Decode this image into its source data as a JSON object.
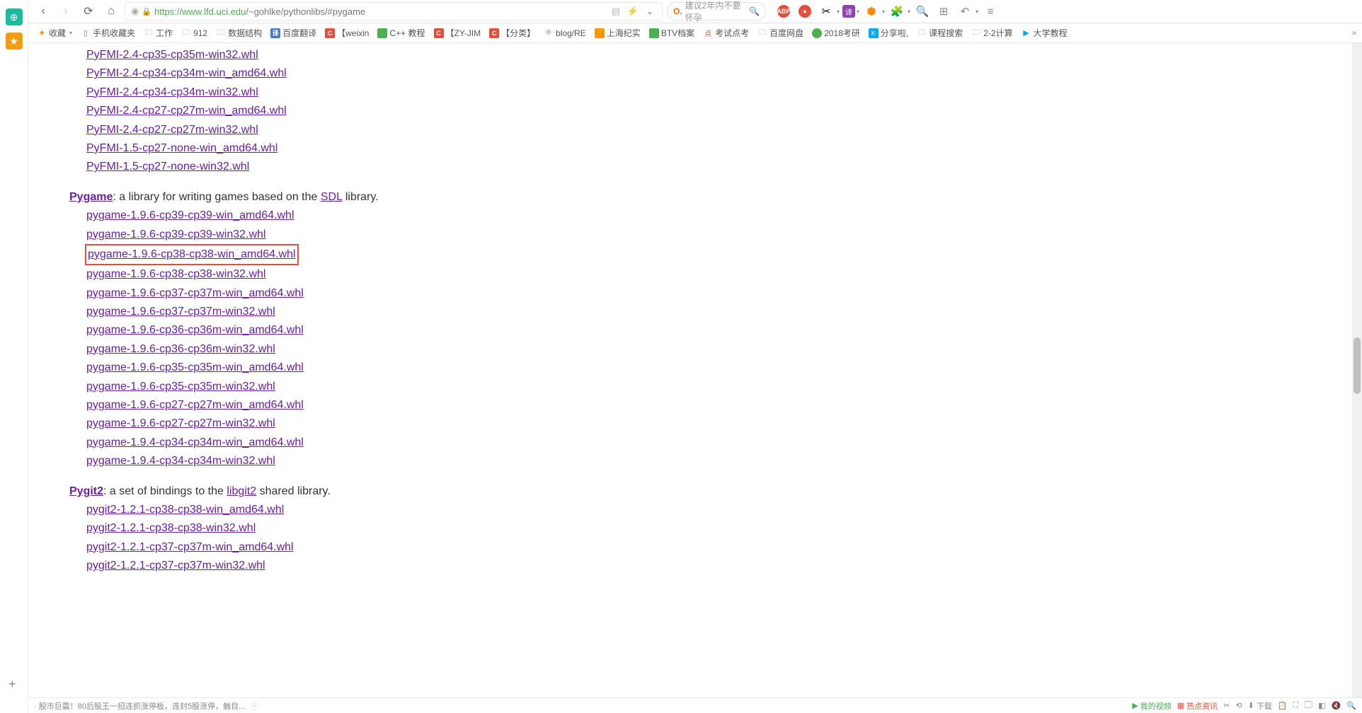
{
  "url": {
    "lock": "🔒",
    "protocol_host": "https://www.lfd.uci.edu",
    "path": "/~gohlke/pythonlibs/",
    "hash": "#pygame"
  },
  "search_suggestion": "建议2年内不要怀孕",
  "bookmarks": [
    {
      "icon": "star",
      "label": "收藏"
    },
    {
      "icon": "phone",
      "label": "手机收藏夹"
    },
    {
      "icon": "folder",
      "label": "工作"
    },
    {
      "icon": "folder",
      "label": "912"
    },
    {
      "icon": "folder",
      "label": "数据结构"
    },
    {
      "icon": "sq-blue",
      "iconText": "译",
      "label": "百度翻译"
    },
    {
      "icon": "sq-red",
      "iconText": "C",
      "label": "【weixin"
    },
    {
      "icon": "sq-green",
      "iconText": "",
      "label": "C++ 教程"
    },
    {
      "icon": "sq-red",
      "iconText": "C",
      "label": "【ZY-JIM"
    },
    {
      "icon": "sq-red",
      "iconText": "C",
      "label": "【分类】"
    },
    {
      "icon": "gh",
      "iconText": "⌾",
      "label": "blog/RE"
    },
    {
      "icon": "sq-orange",
      "iconText": "",
      "label": "上海纪实"
    },
    {
      "icon": "sq-green",
      "iconText": "",
      "label": "BTV档案"
    },
    {
      "icon": "dot-red",
      "iconText": "点",
      "label": "考试点考"
    },
    {
      "icon": "folder",
      "label": "百度网盘"
    },
    {
      "icon": "circ-green",
      "iconText": "",
      "label": "2018考研"
    },
    {
      "icon": "sq-cyan",
      "iconText": "K",
      "label": "分享啦,"
    },
    {
      "icon": "folder",
      "label": "课程搜索"
    },
    {
      "icon": "folder",
      "label": "2-2计算"
    },
    {
      "icon": "circ-blue",
      "iconText": "▶",
      "label": "大学教程"
    }
  ],
  "sections": {
    "pyfmi": {
      "files": [
        "PyFMI-2.4-cp35-cp35m-win32.whl",
        "PyFMI-2.4-cp34-cp34m-win_amd64.whl",
        "PyFMI-2.4-cp34-cp34m-win32.whl",
        "PyFMI-2.4-cp27-cp27m-win_amd64.whl",
        "PyFMI-2.4-cp27-cp27m-win32.whl",
        "PyFMI-1.5-cp27-none-win_amd64.whl",
        "PyFMI-1.5-cp27-none-win32.whl"
      ]
    },
    "pygame": {
      "title": "Pygame",
      "desc_pre": ": a library for writing games based on the ",
      "desc_link": "SDL",
      "desc_post": " library.",
      "files": [
        "pygame-1.9.6-cp39-cp39-win_amd64.whl",
        "pygame-1.9.6-cp39-cp39-win32.whl",
        "pygame-1.9.6-cp38-cp38-win_amd64.whl",
        "pygame-1.9.6-cp38-cp38-win32.whl",
        "pygame-1.9.6-cp37-cp37m-win_amd64.whl",
        "pygame-1.9.6-cp37-cp37m-win32.whl",
        "pygame-1.9.6-cp36-cp36m-win_amd64.whl",
        "pygame-1.9.6-cp36-cp36m-win32.whl",
        "pygame-1.9.6-cp35-cp35m-win_amd64.whl",
        "pygame-1.9.6-cp35-cp35m-win32.whl",
        "pygame-1.9.6-cp27-cp27m-win_amd64.whl",
        "pygame-1.9.6-cp27-cp27m-win32.whl",
        "pygame-1.9.4-cp34-cp34m-win_amd64.whl",
        "pygame-1.9.4-cp34-cp34m-win32.whl"
      ],
      "highlight_index": 2
    },
    "pygit2": {
      "title": "Pygit2",
      "desc_pre": ": a set of bindings to the ",
      "desc_link": "libgit2",
      "desc_post": " shared library.",
      "files": [
        "pygit2-1.2.1-cp38-cp38-win_amd64.whl",
        "pygit2-1.2.1-cp38-cp38-win32.whl",
        "pygit2-1.2.1-cp37-cp37m-win_amd64.whl",
        "pygit2-1.2.1-cp37-cp37m-win32.whl"
      ]
    }
  },
  "bottombar": {
    "news": "· 股市巨震！80后股王一招连抓涨停板，连封5股涨停，触目...",
    "right": [
      {
        "color": "green",
        "label": "我的视频"
      },
      {
        "color": "red",
        "label": "热点资讯"
      }
    ],
    "download": "下载"
  }
}
